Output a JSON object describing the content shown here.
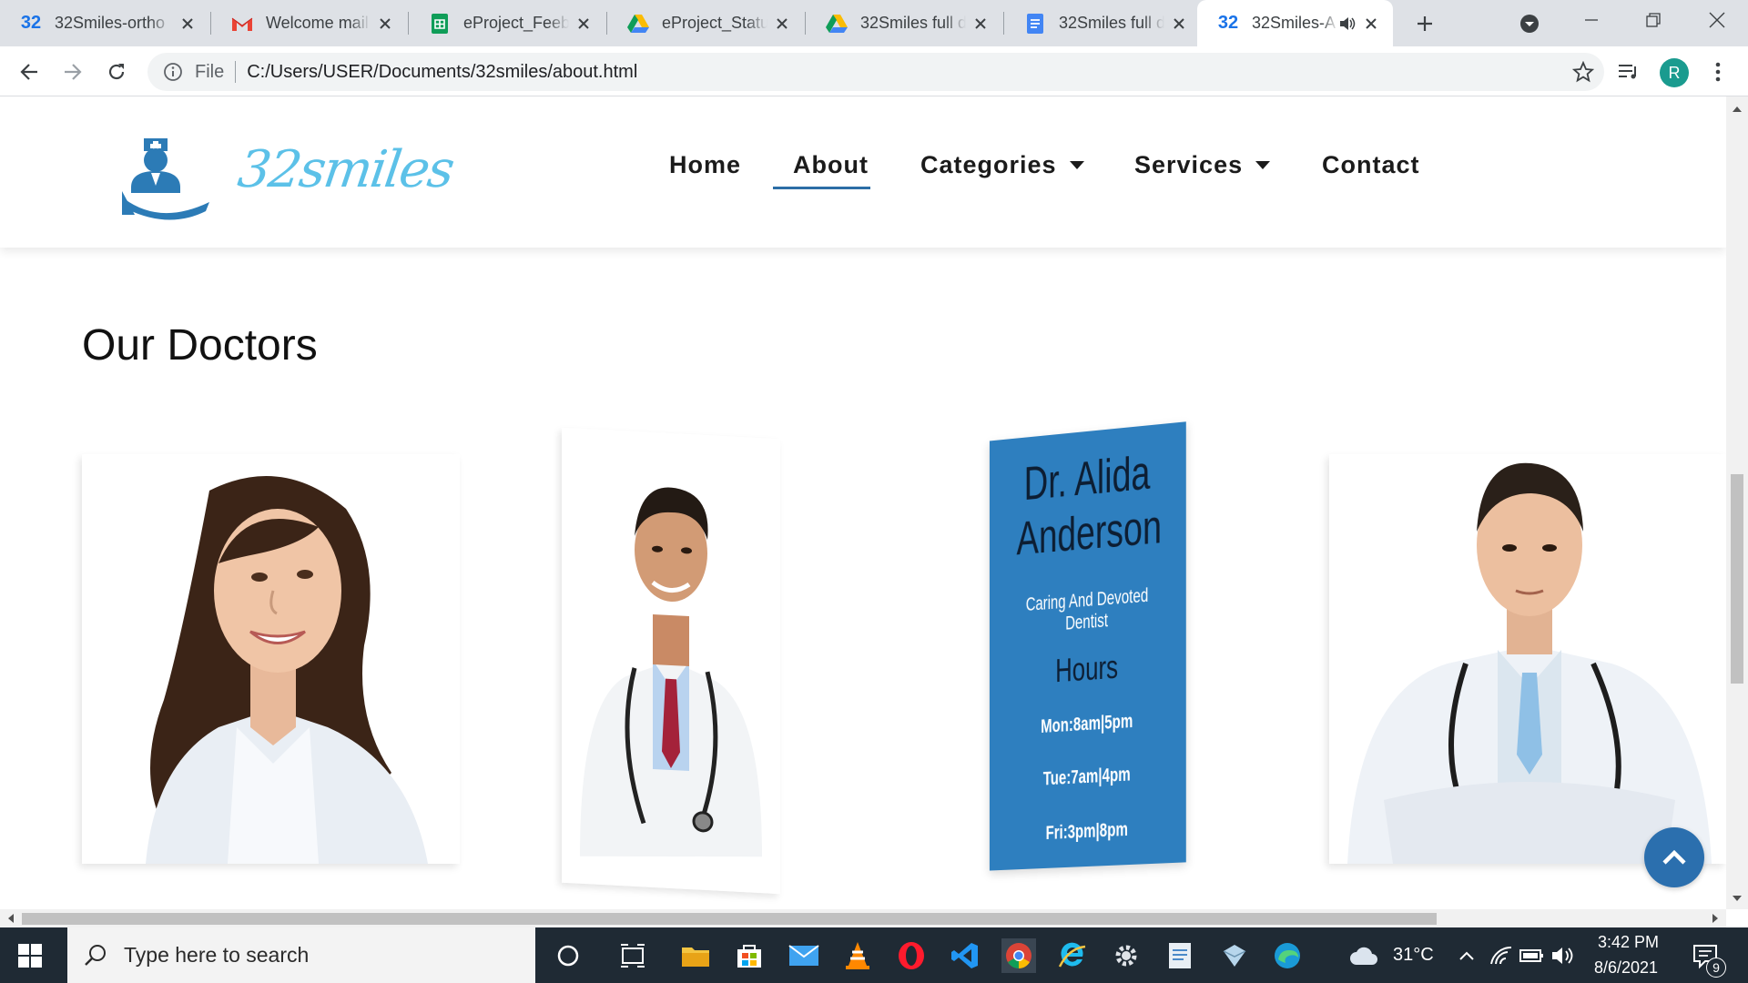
{
  "browser": {
    "tabs": [
      {
        "title": "32Smiles-ortho",
        "icon": "32-favicon"
      },
      {
        "title": "Welcome mail",
        "icon": "gmail-icon"
      },
      {
        "title": "eProject_Feeba",
        "icon": "sheets-icon"
      },
      {
        "title": "eProject_Status",
        "icon": "drive-icon"
      },
      {
        "title": "32Smiles full d",
        "icon": "drive-icon"
      },
      {
        "title": "32Smiles full d",
        "icon": "docs-icon"
      },
      {
        "title": "32Smiles-A",
        "icon": "32-favicon"
      }
    ],
    "active_tab_index": 6,
    "scheme_label": "File",
    "url": "C:/Users/USER/Documents/32smiles/about.html",
    "profile_initial": "R"
  },
  "site": {
    "logo_text": "32smiles",
    "nav": {
      "home": "Home",
      "about": "About",
      "categories": "Categories",
      "services": "Services",
      "contact": "Contact"
    },
    "section_title": "Our Doctors",
    "doctor_card": {
      "name_line1": "Dr. Alida",
      "name_line2": "Anderson",
      "tagline": "Caring And Devoted Dentist",
      "hours_title": "Hours",
      "hours": [
        "Mon:8am|5pm",
        "Tue:7am|4pm",
        "Fri:3pm|8pm"
      ]
    }
  },
  "taskbar": {
    "search_placeholder": "Type here to search",
    "temperature": "31°C",
    "time": "3:42 PM",
    "date": "8/6/2021",
    "notification_count": "9"
  },
  "colors": {
    "brand_blue": "#2e7fbf",
    "logo_cyan": "#5cc1e8",
    "nav_active": "#2c6ea6"
  }
}
